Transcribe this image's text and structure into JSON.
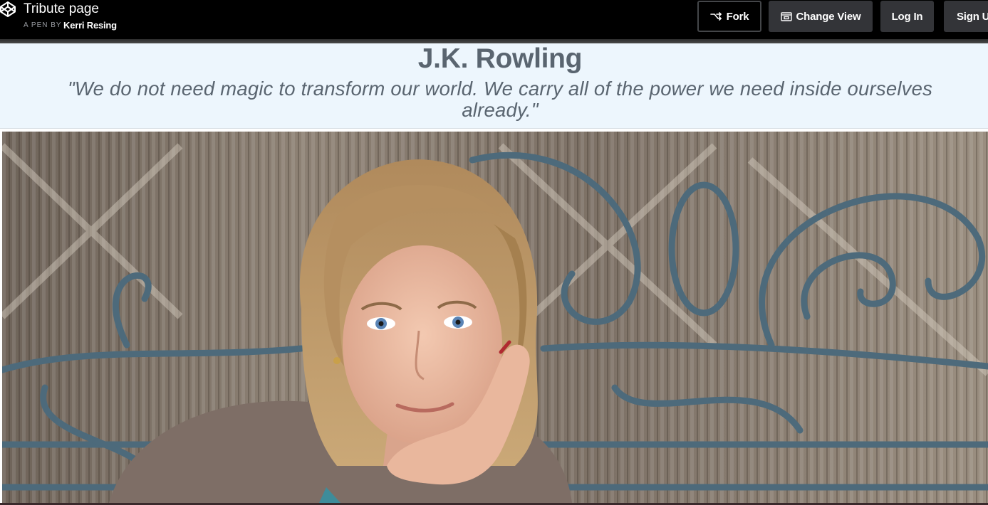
{
  "codepen_bar": {
    "pen_title": "Tribute page",
    "pen_by_label": "A PEN BY",
    "author": "Kerri Resing",
    "buttons": {
      "fork": "Fork",
      "change_view": "Change View",
      "log_in": "Log In",
      "sign_up": "Sign Up"
    }
  },
  "tribute": {
    "name": "J.K. Rowling",
    "quote": "\"We do not need magic to transform our world. We carry all of the power we need inside ourselves already.\""
  },
  "colors": {
    "topbar_bg": "#000000",
    "button_bg": "#333438",
    "header_bg": "#edf6fd",
    "header_text": "#5a6570"
  }
}
